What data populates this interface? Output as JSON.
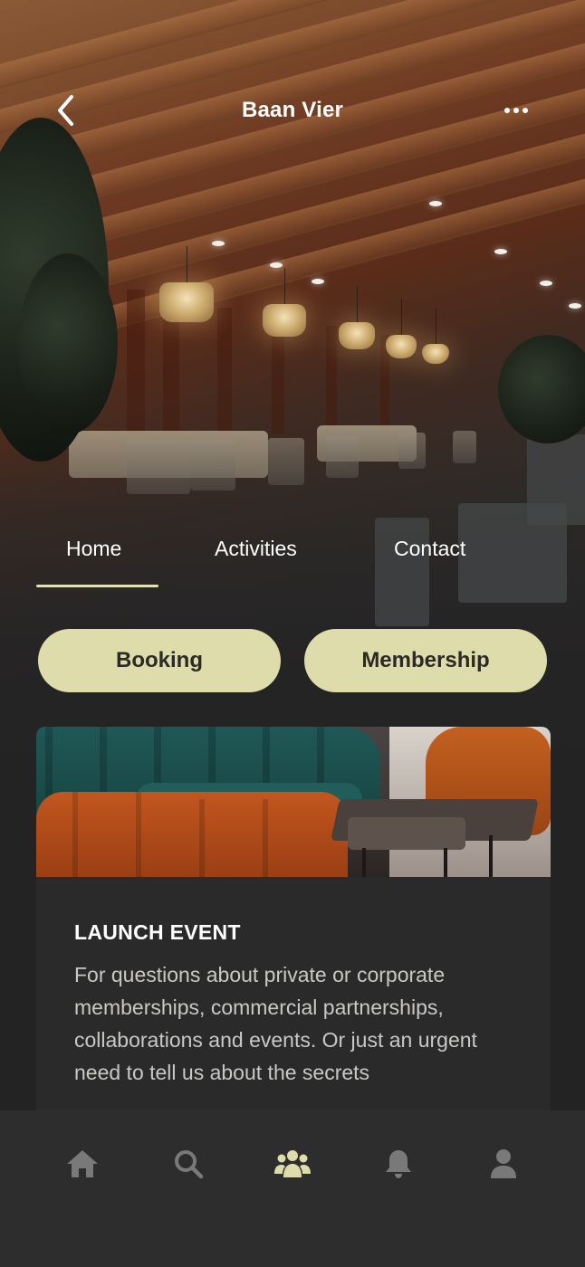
{
  "header": {
    "title": "Baan Vier"
  },
  "tabs": [
    {
      "label": "Home",
      "active": true
    },
    {
      "label": "Activities",
      "active": false
    },
    {
      "label": "Contact",
      "active": false
    }
  ],
  "actions": {
    "booking_label": "Booking",
    "membership_label": "Membership"
  },
  "event_card": {
    "title": "LAUNCH EVENT",
    "description": "For questions about private or corporate memberships, commercial partnerships, collaborations and events. Or just an urgent need to tell us about the secrets"
  },
  "bottom_nav": [
    {
      "icon": "home-icon",
      "active": false
    },
    {
      "icon": "search-icon",
      "active": false
    },
    {
      "icon": "community-icon",
      "active": true
    },
    {
      "icon": "bell-icon",
      "active": false
    },
    {
      "icon": "profile-icon",
      "active": false
    }
  ],
  "colors": {
    "accent": "#dddcaa",
    "background": "#242324",
    "card": "#2b2a2b",
    "nav_bg": "#2e2d2e",
    "icon_inactive": "#7a797a",
    "icon_active": "#dddcaa"
  }
}
